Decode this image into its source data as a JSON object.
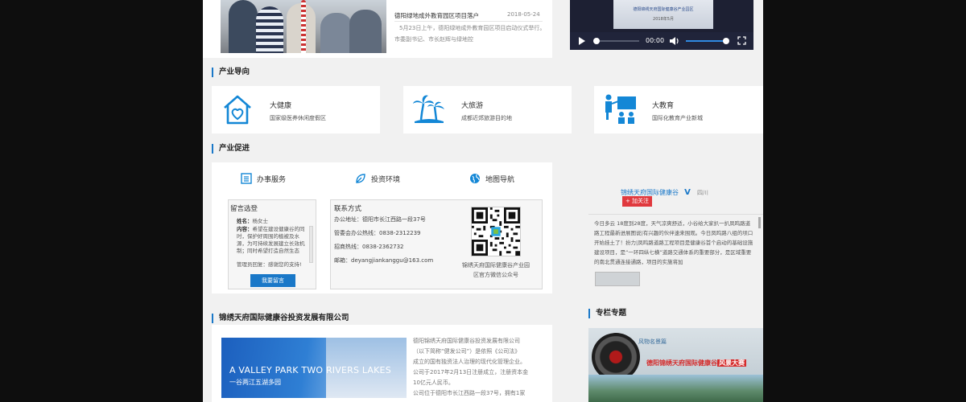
{
  "news": {
    "title": "德阳绿地成外教育园区项目落户",
    "date": "2018-05-24",
    "excerpt_line1": "5月23日上午，德阳绿地成外教育园区项目启动仪式举行。",
    "excerpt_line2": "市委副书记、市长赵辉与绿地控"
  },
  "video": {
    "time": "00:00",
    "slide_line1": "德阳锦绣天府国际健康谷产业园区",
    "slide_line2": "2018年5月"
  },
  "industry_guide": {
    "title": "产业导向",
    "items": [
      {
        "icon": "house-heart-icon",
        "name": "大健康",
        "desc": "国家级医养休闲度假区"
      },
      {
        "icon": "palm-tree-icon",
        "name": "大旅游",
        "desc": "成都近郊旅游目的地"
      },
      {
        "icon": "teacher-board-icon",
        "name": "大教育",
        "desc": "国际化教育产业新城"
      }
    ]
  },
  "promotion": {
    "title": "产业促进",
    "tabs": [
      {
        "icon": "list-icon",
        "label": "办事服务"
      },
      {
        "icon": "leaf-icon",
        "label": "投资环境"
      },
      {
        "icon": "globe-icon",
        "label": "地图导航"
      }
    ],
    "message_board": {
      "title": "留言选登",
      "name_label": "姓名：",
      "name_value": "杨女士",
      "content_label": "内容：",
      "content_text": "希望在建设健康谷的同时，保护好周围的植被及水源，为可持续发展建立长效机制；同时希望打造自然生态",
      "reply_label": "管理员回复：",
      "reply_text": "感谢您的支持!",
      "button": "我要留言"
    },
    "contact": {
      "title": "联系方式",
      "address": "办公地址：德阳市长江西路一段37号",
      "office_phone": "管委会办公热线：0838-2312239",
      "invest_phone": "招商热线：0838-2362732",
      "email": "邮箱：deyangjiankanggu@163.com",
      "qr_caption_line1": "锦绣天府国际健康谷产业园",
      "qr_caption_line2": "区官方微信公众号"
    }
  },
  "weibo": {
    "account": "锦绣天府国际健康谷",
    "verified": "V",
    "location": "四川",
    "follow": "+ 加关注",
    "post": "今日多云 18度到28度，天气凉爽舒适，小谷给大家扒一扒凤鸣路道路工程最新进展图说|有兴趣的伙伴速来围观。今日凤鸣路八组的坝口开始挂土了！扮力|凤鸣路道路工程项目是健康谷首个启动的基础设施建设项目，是“一环四纵七横”道路交通体系的重要部分，是区域重要的南北贯通连接通路，项目的实施将加"
  },
  "company": {
    "title": "锦绣天府国际健康谷投资发展有限公司",
    "banner_text": "A VALLEY PARK TWO RIVERS LAKES",
    "banner_sub": "一谷两江五湖多园",
    "intro_lines": [
      "德阳锦绣天府国际健康谷投资发展有限公司",
      "（以下简称“健发公司”）是依照《公司法》",
      "成立的国有独资法人治理的现代化管理企业。",
      "公司于2017年2月13日注册成立，注册资本金",
      "10亿元人民币。",
      "公司位于德阳市长江西路一段37号，拥有1家"
    ]
  },
  "column": {
    "title": "专栏专题",
    "badge": "风物名景篇",
    "headline": "德阳锦绣天府国际健康谷",
    "highlight": "风景大赛"
  },
  "colors": {
    "accent": "#1a78c8",
    "icon_blue": "#1387d6",
    "follow_red": "#e0393e"
  }
}
